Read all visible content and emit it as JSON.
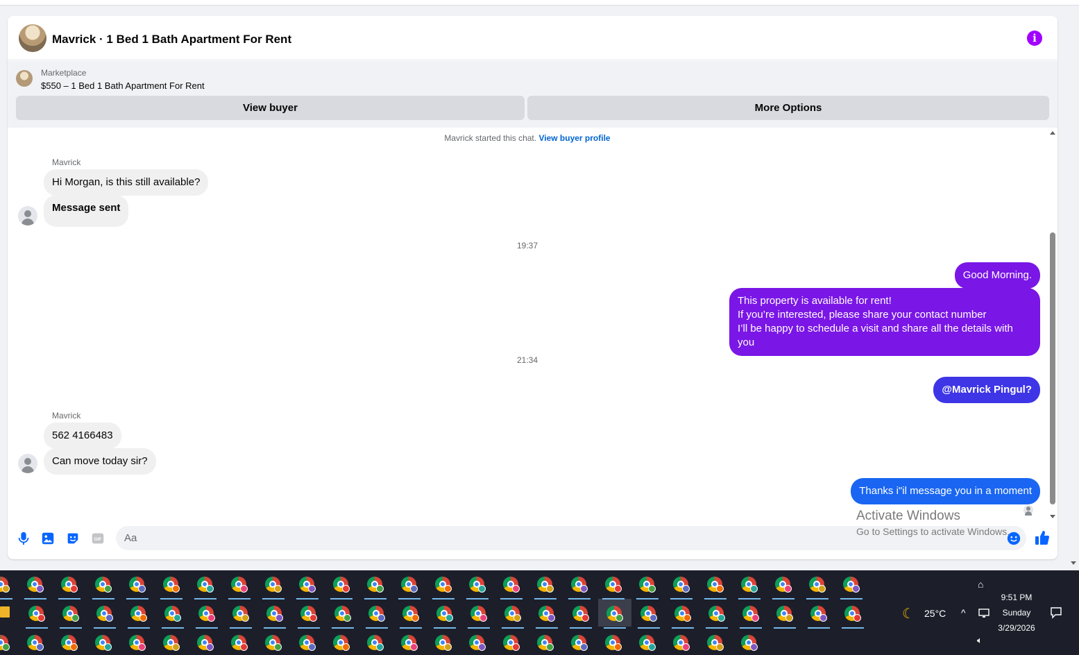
{
  "header": {
    "title": "Mavrick · 1 Bed 1 Bath Apartment For Rent"
  },
  "listing": {
    "label": "Marketplace",
    "price_title": "$550 – 1 Bed 1 Bath Apartment For Rent",
    "view_buyer": "View buyer",
    "more_options": "More Options"
  },
  "conversation": {
    "started_text": "Mavrick started this chat.",
    "profile_link": "View buyer profile",
    "sender_name": "Mavrick",
    "msg1": "Hi Morgan, is this still available?",
    "msg2": "Message sent",
    "time1": "19:37",
    "reply1": "Good Morning.",
    "reply2_line1": "This property is available for rent!",
    "reply2_line2": "If you’re interested, please share your contact number",
    "reply2_line3": "I’ll be happy to schedule a visit and share all the details with you",
    "time2": "21:34",
    "reply3": "@Mavrick Pingul?",
    "msg3": "562 4166483",
    "msg4": "Can move today sir?",
    "reply4": "Thanks i\"il message you in a moment"
  },
  "composer": {
    "placeholder": "Aa",
    "icons": [
      "microphone-icon",
      "image-icon",
      "sticker-icon",
      "gif-icon",
      "emoji-icon",
      "thumbs-up-icon"
    ]
  },
  "watermark": {
    "line1": "Activate Windows",
    "line2": "Go to Settings to activate Windows."
  },
  "taskbar": {
    "temperature": "25°C",
    "time": "9:51 PM",
    "day": "Sunday",
    "date": "3/29/2026"
  },
  "colors": {
    "info": "#a100ff",
    "bubble_purple": "#7a16e6",
    "bubble_indigo": "#3d35e6",
    "bubble_blue": "#1a66f2",
    "link": "#0064d1",
    "composer_icon": "#0866ff"
  }
}
